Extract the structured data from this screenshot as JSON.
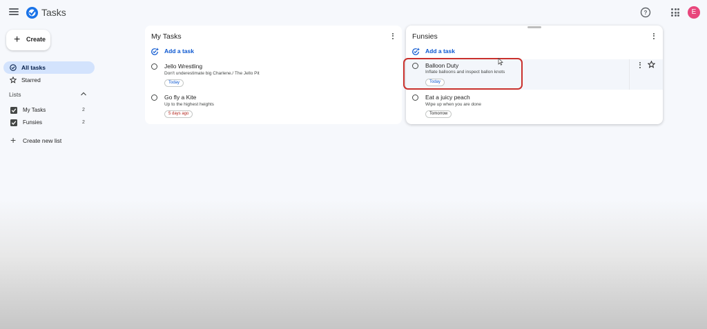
{
  "header": {
    "app_title": "Tasks",
    "avatar_initial": "E",
    "icons": [
      "menu-icon",
      "tasks-logo-icon",
      "help-icon",
      "apps-grid-icon"
    ]
  },
  "sidebar": {
    "create_label": "Create",
    "nav": [
      {
        "label": "All tasks",
        "icon": "all-tasks-icon",
        "active": true
      },
      {
        "label": "Starred",
        "icon": "star-icon",
        "active": false
      }
    ],
    "lists_heading": "Lists",
    "lists": [
      {
        "label": "My Tasks",
        "count": "2",
        "checked": true
      },
      {
        "label": "Funsies",
        "count": "2",
        "checked": true
      }
    ],
    "create_new_list_label": "Create new list"
  },
  "cards": [
    {
      "title": "My Tasks",
      "add_task_label": "Add a task",
      "tasks": [
        {
          "title": "Jello Wrestling",
          "description": "Don't underestimate big Charlene./ The Jello Pit",
          "due": "Today",
          "due_color": "#0b57d0"
        },
        {
          "title": "Go fly a Kite",
          "description": "Up to the highest heights",
          "due": "5 days ago",
          "due_color": "#b3261e"
        }
      ]
    },
    {
      "title": "Funsies",
      "add_task_label": "Add a task",
      "tasks": [
        {
          "title": "Balloon Duty",
          "description": "Inflate balloons and inspect ballon knots",
          "due": "Today",
          "due_color": "#0b57d0"
        },
        {
          "title": "Eat a juicy peach",
          "description": "Wipe up when you are done",
          "due": "Tomorrow",
          "due_color": "#1f1f1f"
        }
      ]
    }
  ],
  "colors": {
    "accent": "#0b57d0",
    "active_nav_bg": "#d3e3fd",
    "highlight_box": "#c9302c",
    "avatar_bg": "#e8467c"
  }
}
